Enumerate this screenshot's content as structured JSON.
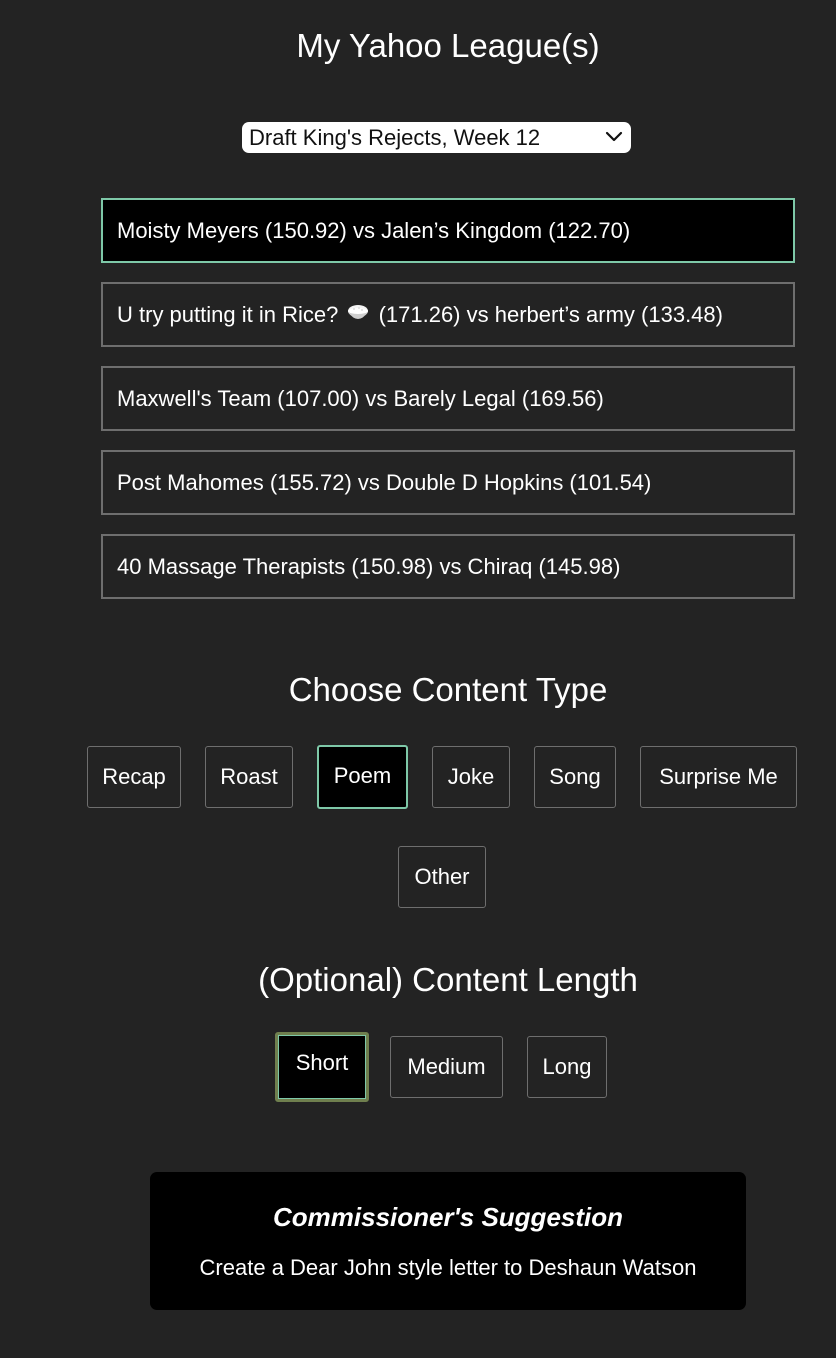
{
  "header": {
    "title": "My Yahoo League(s)"
  },
  "league_select": {
    "selected": "Draft King's Rejects, Week 12",
    "icon": "chevron-down-icon"
  },
  "matchups": [
    {
      "label": "Moisty Meyers (150.92) vs Jalen’s Kingdom (122.70)",
      "selected": true
    },
    {
      "label_before": "U try putting it in Rice?",
      "label_after": "(171.26) vs herbert’s army (133.48)",
      "icon": "rice-bowl-icon",
      "selected": false
    },
    {
      "label": "Maxwell's Team (107.00) vs Barely Legal (169.56)",
      "selected": false
    },
    {
      "label": "Post Mahomes (155.72) vs Double D Hopkins (101.54)",
      "selected": false
    },
    {
      "label": "40 Massage Therapists (150.98) vs Chiraq (145.98)",
      "selected": false
    }
  ],
  "content_type": {
    "title": "Choose Content Type",
    "options": [
      "Recap",
      "Roast",
      "Poem",
      "Joke",
      "Song",
      "Surprise Me",
      "Other"
    ],
    "selected": "Poem"
  },
  "content_length": {
    "title": "(Optional) Content Length",
    "options": [
      "Short",
      "Medium",
      "Long"
    ],
    "selected": "Short"
  },
  "suggestion": {
    "title": "Commissioner's Suggestion",
    "text": "Create a Dear John style letter to Deshaun Watson"
  },
  "colors": {
    "background": "#232323",
    "selected_border": "#7ec8a8",
    "selected_fill": "#000000",
    "chip_border": "#6e6e6e"
  }
}
